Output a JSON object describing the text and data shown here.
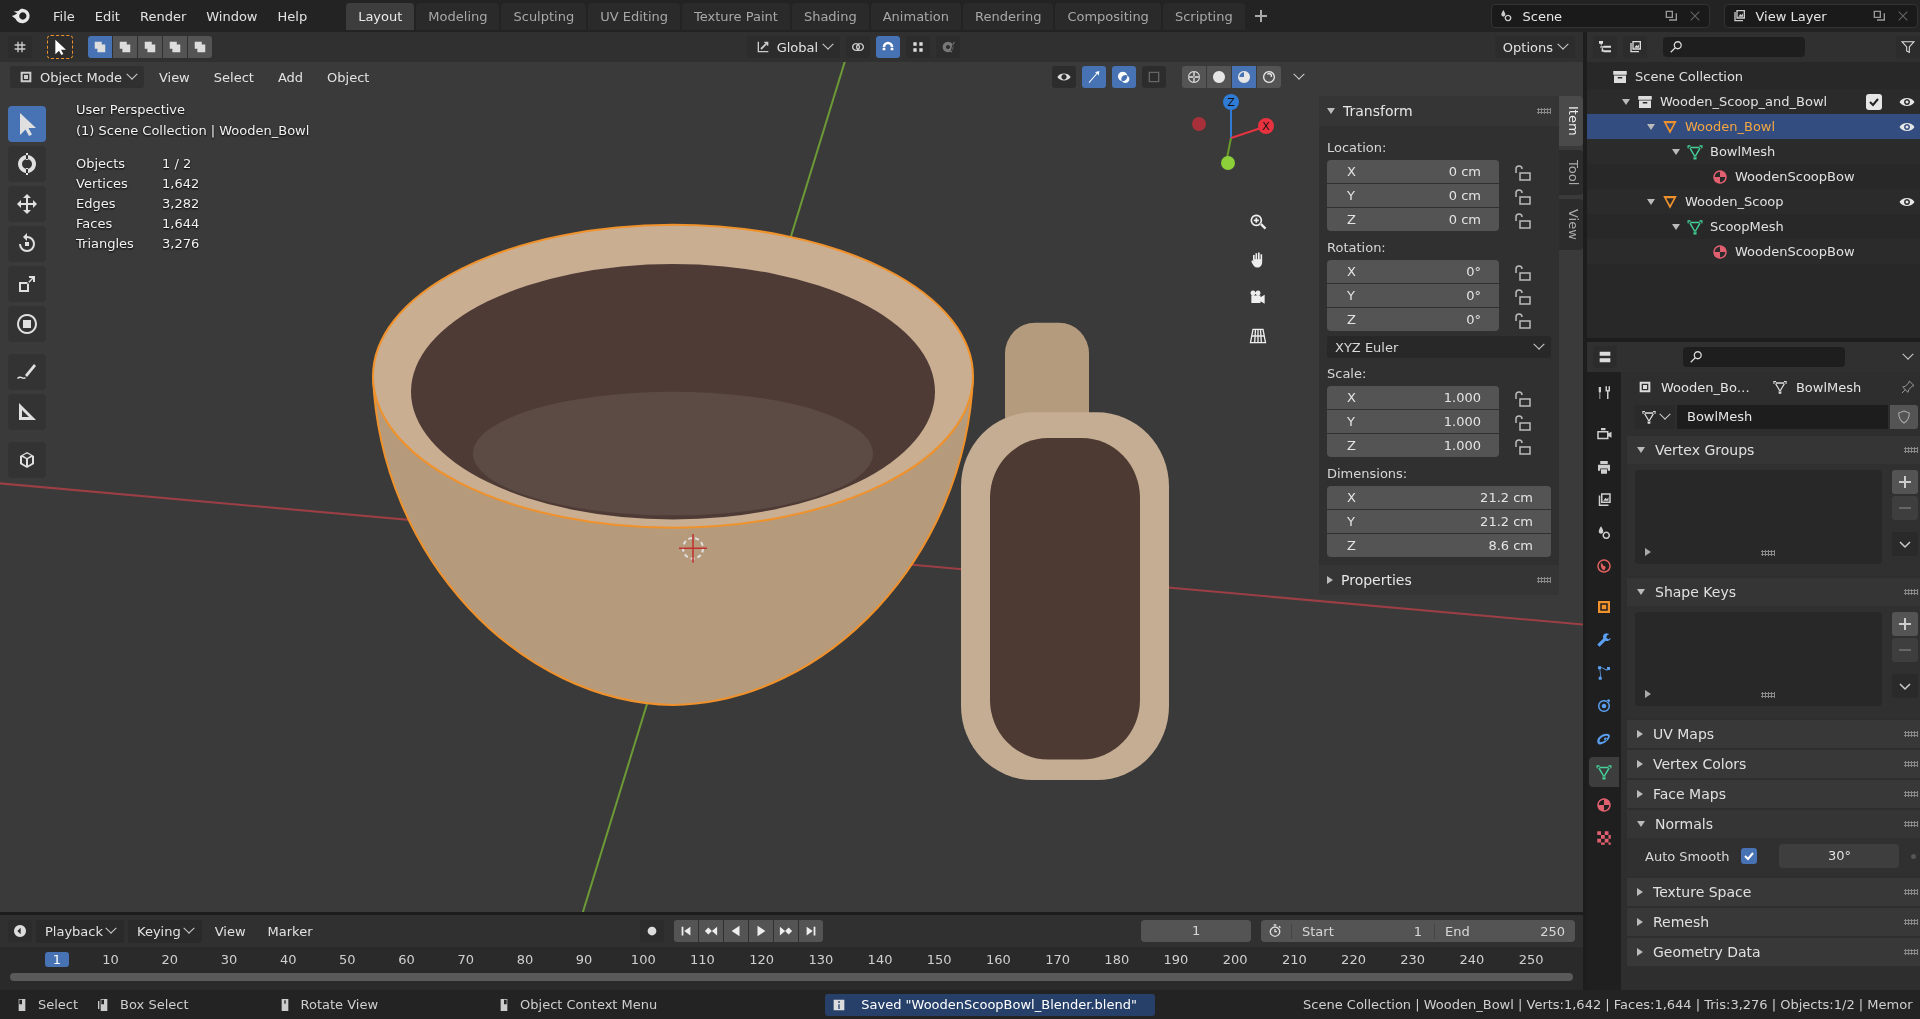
{
  "top_bar": {
    "menus": [
      "File",
      "Edit",
      "Render",
      "Window",
      "Help"
    ],
    "workspaces": [
      {
        "label": "Layout",
        "selected": true
      },
      {
        "label": "Modeling",
        "selected": false
      },
      {
        "label": "Sculpting",
        "selected": false
      },
      {
        "label": "UV Editing",
        "selected": false
      },
      {
        "label": "Texture Paint",
        "selected": false
      },
      {
        "label": "Shading",
        "selected": false
      },
      {
        "label": "Animation",
        "selected": false
      },
      {
        "label": "Rendering",
        "selected": false
      },
      {
        "label": "Compositing",
        "selected": false
      },
      {
        "label": "Scripting",
        "selected": false
      }
    ],
    "scene": "Scene",
    "view_layer": "View Layer"
  },
  "tool_settings": {
    "orientation": "Global",
    "options": "Options"
  },
  "viewport": {
    "mode": "Object Mode",
    "menus": [
      "View",
      "Select",
      "Add",
      "Object"
    ],
    "tools": [
      {
        "kind": "select",
        "selected": true
      },
      {
        "kind": "cursor",
        "selected": false
      },
      {
        "kind": "move",
        "selected": false
      },
      {
        "kind": "rotate",
        "selected": false
      },
      {
        "kind": "scale",
        "selected": false
      },
      {
        "kind": "transform",
        "selected": false
      },
      {
        "kind": "annotate",
        "selected": false
      },
      {
        "kind": "measure",
        "selected": false
      },
      {
        "kind": "add_cube",
        "selected": false
      }
    ],
    "view_name": "User Perspective",
    "context": "(1) Scene Collection | Wooden_Bowl",
    "stats": [
      {
        "label": "Objects",
        "value": "1 / 2"
      },
      {
        "label": "Vertices",
        "value": "1,642"
      },
      {
        "label": "Edges",
        "value": "3,282"
      },
      {
        "label": "Faces",
        "value": "1,644"
      },
      {
        "label": "Triangles",
        "value": "3,276"
      }
    ],
    "gizmo_labels": [
      "Z",
      "X"
    ],
    "shading": [
      {
        "kind": "wireframe",
        "selected": false
      },
      {
        "kind": "solid",
        "selected": false
      },
      {
        "kind": "material",
        "selected": true
      },
      {
        "kind": "rendered",
        "selected": false
      }
    ]
  },
  "sidebar": {
    "tabs": [
      {
        "label": "Item",
        "selected": true
      },
      {
        "label": "Tool",
        "selected": false
      },
      {
        "label": "View",
        "selected": false
      }
    ],
    "transform": {
      "title": "Transform",
      "expanded": true,
      "groups": [
        {
          "kind": "vector",
          "label": "Location:",
          "fields": [
            {
              "axis": "X",
              "value": "0 cm"
            },
            {
              "axis": "Y",
              "value": "0 cm"
            },
            {
              "axis": "Z",
              "value": "0 cm"
            }
          ]
        },
        {
          "kind": "vector",
          "label": "Rotation:",
          "fields": [
            {
              "axis": "X",
              "value": "0°"
            },
            {
              "axis": "Y",
              "value": "0°"
            },
            {
              "axis": "Z",
              "value": "0°"
            }
          ]
        },
        {
          "kind": "dropdown",
          "value": "XYZ Euler"
        },
        {
          "kind": "vector",
          "label": "Scale:",
          "fields": [
            {
              "axis": "X",
              "value": "1.000"
            },
            {
              "axis": "Y",
              "value": "1.000"
            },
            {
              "axis": "Z",
              "value": "1.000"
            }
          ]
        },
        {
          "kind": "wide",
          "label": "Dimensions:",
          "fields": [
            {
              "axis": "X",
              "value": "21.2 cm"
            },
            {
              "axis": "Y",
              "value": "21.2 cm"
            },
            {
              "axis": "Z",
              "value": "8.6 cm"
            }
          ]
        }
      ]
    },
    "properties": {
      "title": "Properties",
      "expanded": false
    }
  },
  "outliner": {
    "tree": [
      {
        "label": "Scene Collection",
        "kind": "scene_collection",
        "selected": false,
        "children": [
          {
            "label": "Wooden_Scoop_and_Bowl",
            "kind": "collection",
            "selected": false,
            "expanded": true,
            "checked": true,
            "visible": true,
            "children": [
              {
                "label": "Wooden_Bowl",
                "kind": "object",
                "selected": true,
                "expanded": true,
                "visible": true,
                "children": [
                  {
                    "label": "BowlMesh",
                    "kind": "mesh",
                    "selected": false,
                    "expanded": true,
                    "children": [
                      {
                        "label": "WoodenScoopBow",
                        "kind": "material",
                        "selected": false
                      }
                    ]
                  }
                ]
              },
              {
                "label": "Wooden_Scoop",
                "kind": "object",
                "selected": false,
                "expanded": true,
                "visible": true,
                "children": [
                  {
                    "label": "ScoopMesh",
                    "kind": "mesh",
                    "selected": false,
                    "expanded": true,
                    "children": [
                      {
                        "label": "WoodenScoopBow",
                        "kind": "material",
                        "selected": false
                      }
                    ]
                  }
                ]
              }
            ]
          }
        ]
      }
    ]
  },
  "properties_editor": {
    "tabs": [
      {
        "kind": "tool",
        "selected": false
      },
      {
        "kind": "render",
        "selected": false
      },
      {
        "kind": "output",
        "selected": false
      },
      {
        "kind": "view_layer",
        "selected": false
      },
      {
        "kind": "scene",
        "selected": false
      },
      {
        "kind": "world",
        "selected": false
      },
      {
        "kind": "object",
        "selected": false
      },
      {
        "kind": "modifiers",
        "selected": false
      },
      {
        "kind": "particles",
        "selected": false
      },
      {
        "kind": "physics",
        "selected": false
      },
      {
        "kind": "constraints",
        "selected": false
      },
      {
        "kind": "data",
        "selected": true
      },
      {
        "kind": "material",
        "selected": false
      },
      {
        "kind": "texture",
        "selected": false
      }
    ],
    "breadcrumb": {
      "object": "Wooden_Bo…",
      "data": "BowlMesh"
    },
    "mesh_name": "BowlMesh",
    "panels": [
      {
        "title": "Vertex Groups",
        "kind": "list",
        "expanded": true
      },
      {
        "title": "Shape Keys",
        "kind": "list",
        "expanded": true
      },
      {
        "title": "UV Maps",
        "kind": "plain",
        "expanded": false
      },
      {
        "title": "Vertex Colors",
        "kind": "plain",
        "expanded": false
      },
      {
        "title": "Face Maps",
        "kind": "plain",
        "expanded": false
      },
      {
        "title": "Normals",
        "kind": "normals",
        "expanded": true,
        "auto_smooth": {
          "label": "Auto Smooth",
          "checked": true,
          "angle": "30°"
        }
      },
      {
        "title": "Texture Space",
        "kind": "plain",
        "expanded": false
      },
      {
        "title": "Remesh",
        "kind": "plain",
        "expanded": false
      },
      {
        "title": "Geometry Data",
        "kind": "plain",
        "expanded": false
      }
    ]
  },
  "timeline": {
    "menus": [
      "Playback",
      "Keying",
      "View",
      "Marker"
    ],
    "current_frame": "1",
    "start_label": "Start",
    "start": "1",
    "end_label": "End",
    "end": "250",
    "playhead": "1",
    "ticks": [
      "10",
      "20",
      "30",
      "40",
      "50",
      "60",
      "70",
      "80",
      "90",
      "100",
      "110",
      "120",
      "130",
      "140",
      "150",
      "160",
      "170",
      "180",
      "190",
      "200",
      "210",
      "220",
      "230",
      "240",
      "250"
    ]
  },
  "status_bar": {
    "hints": [
      {
        "kind": "left",
        "label": "Select"
      },
      {
        "kind": "left_drag",
        "label": "Box Select"
      },
      {
        "kind": "middle",
        "label": "Rotate View"
      },
      {
        "kind": "right",
        "label": "Object Context Menu"
      }
    ],
    "message": "Saved \"WoodenScoopBowl_Blender.blend\"",
    "stats": "Scene Collection | Wooden_Bowl | Verts:1,642 | Faces:1,644 | Tris:3,276 | Objects:1/2 | Memor"
  }
}
